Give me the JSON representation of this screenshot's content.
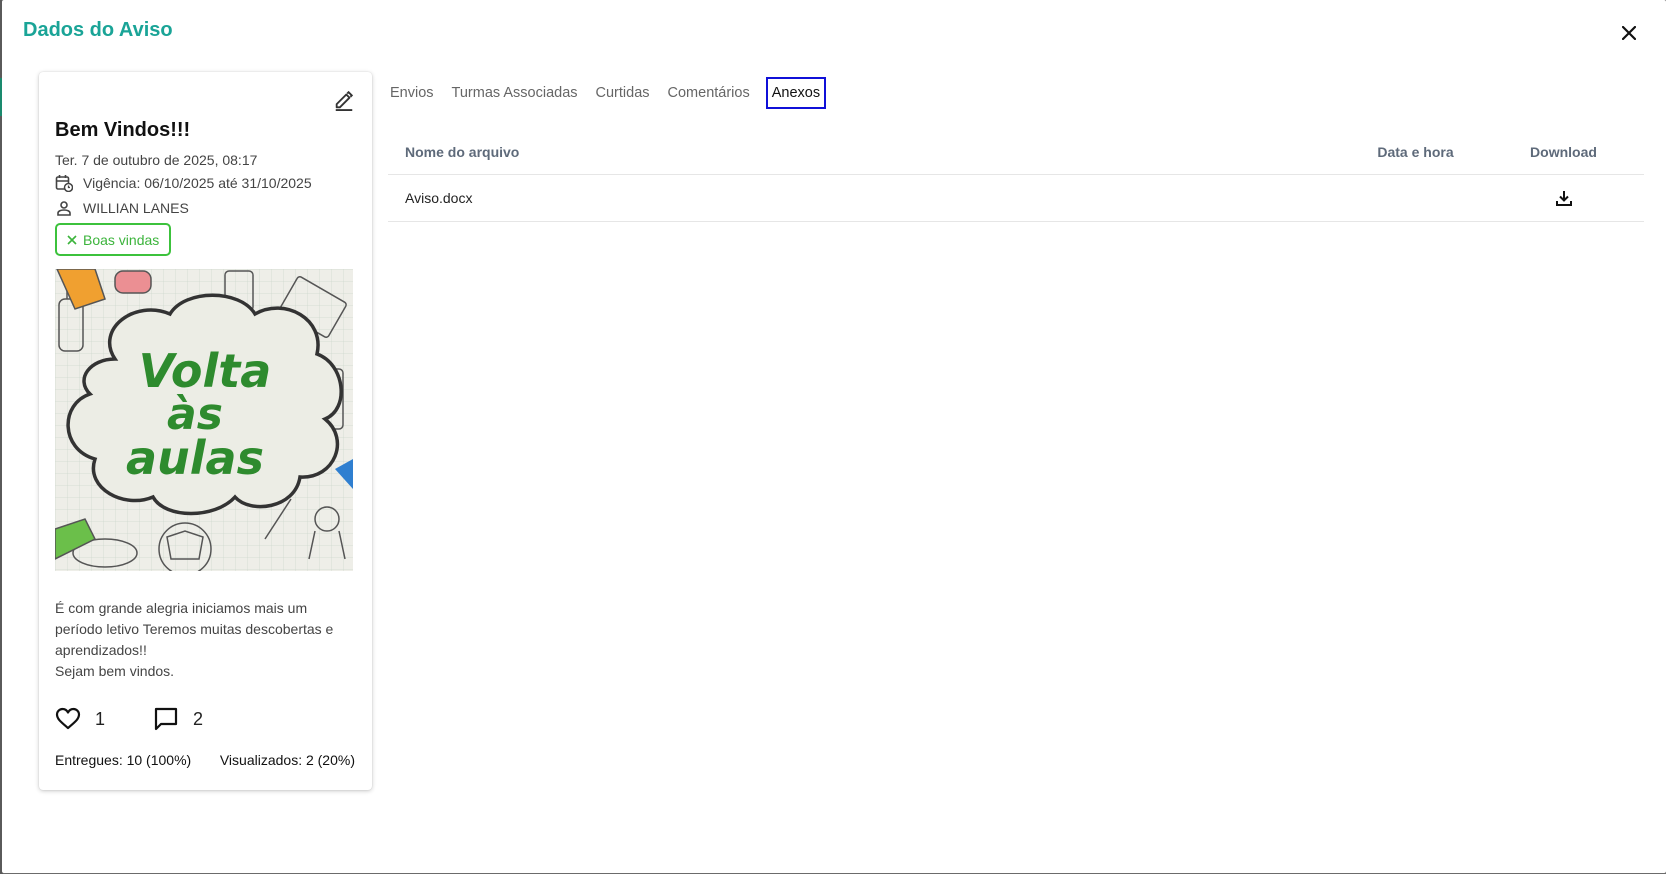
{
  "modal": {
    "title": "Dados do Aviso"
  },
  "card": {
    "title": "Bem Vindos!!!",
    "date": "Ter. 7 de outubro de 2025, 08:17",
    "validity": "Vigência: 06/10/2025 até 31/10/2025",
    "author": "WILLIAN LANES",
    "tag": "Boas vindas",
    "poster_text": [
      "Volta",
      "às",
      "aulas"
    ],
    "body_lines": [
      "É com grande alegria iniciamos mais um",
      "período letivo Teremos muitas descobertas e",
      "aprendizados!!",
      "Sejam bem vindos."
    ],
    "likes": "1",
    "comments": "2",
    "delivered": "Entregues: 10 (100%)",
    "viewed": "Visualizados: 2 (20%)"
  },
  "tabs": [
    {
      "label": "Envios"
    },
    {
      "label": "Turmas Associadas"
    },
    {
      "label": "Curtidas"
    },
    {
      "label": "Comentários"
    },
    {
      "label": "Anexos"
    }
  ],
  "table": {
    "headers": [
      "Nome do arquivo",
      "Data e hora",
      "Download"
    ],
    "rows": [
      {
        "name": "Aviso.docx",
        "datetime": ""
      }
    ]
  },
  "colors": {
    "title": "#1aa497",
    "tag": "#3cc23c",
    "active_tab_border": "#1010d8",
    "poster_text": "#2e8b2e"
  },
  "icons": {
    "close": "close-icon",
    "edit": "pencil-icon",
    "calendar": "calendar-clock-icon",
    "user": "person-icon",
    "chip_remove": "close-icon",
    "like": "heart-icon",
    "comment": "comment-icon",
    "download": "download-icon"
  }
}
